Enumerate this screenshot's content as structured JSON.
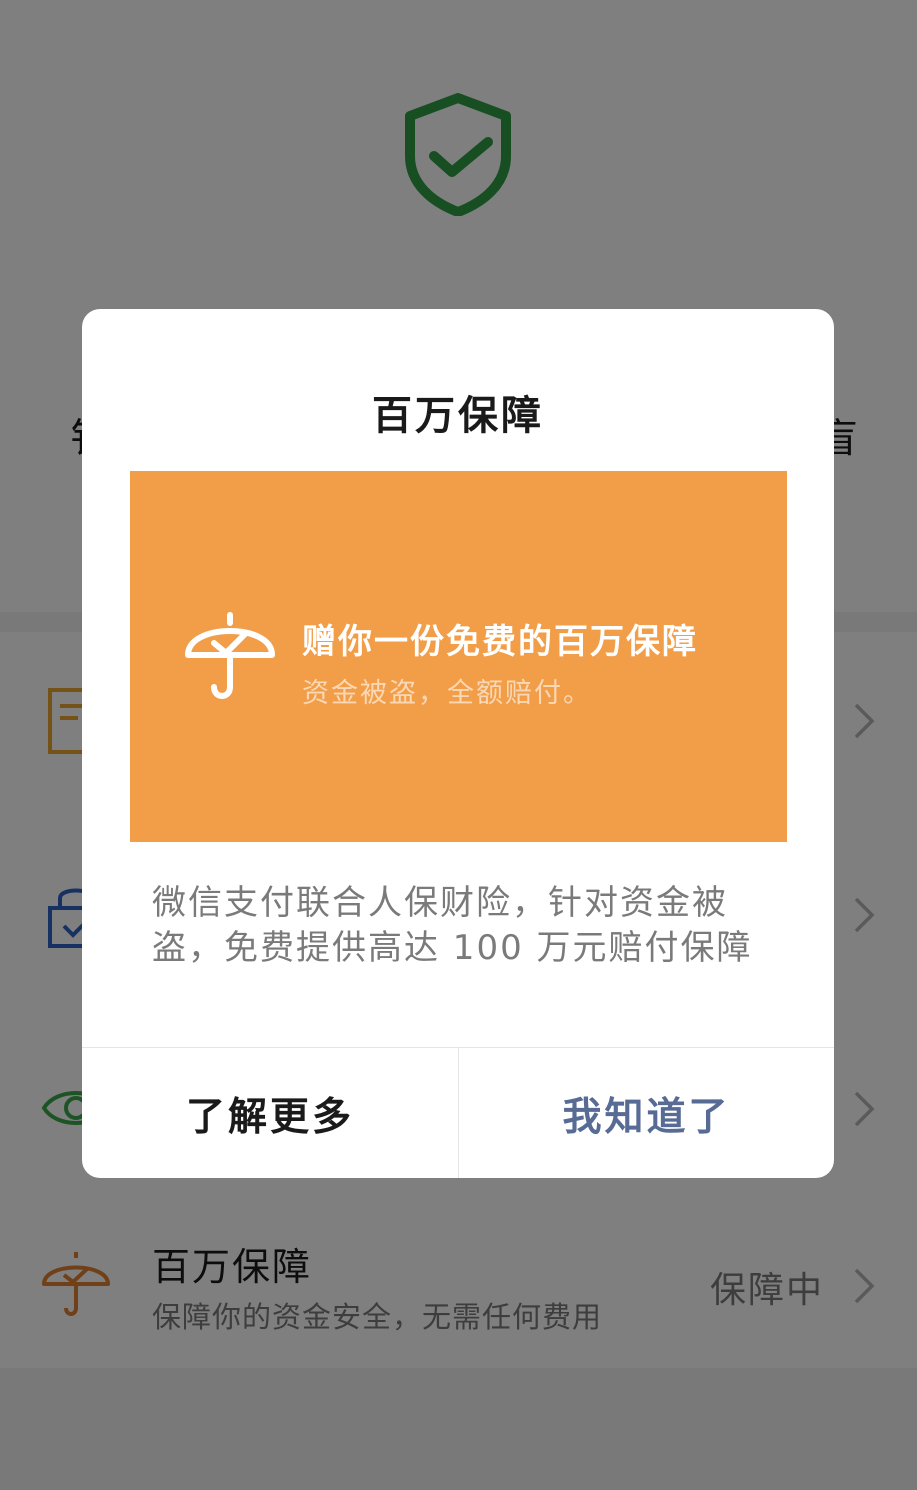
{
  "background": {
    "hero_left_text": "钅",
    "hero_right_text": "盲",
    "rows": [
      {
        "icon": "document-icon",
        "icon_color": "#e9a531"
      },
      {
        "icon": "lock-check-icon",
        "icon_color": "#2f62c6"
      },
      {
        "icon": "eye-icon",
        "icon_color": "#38a84a"
      },
      {
        "icon": "umbrella-check-icon",
        "icon_color": "#e08130",
        "title": "百万保障",
        "subtitle": "保障你的资金安全，无需任何费用",
        "status": "保障中"
      }
    ]
  },
  "modal": {
    "title": "百万保障",
    "banner": {
      "headline": "赠你一份免费的百万保障",
      "subline": "资金被盗，全额赔付。",
      "color": "#f29e48"
    },
    "description_line1": "微信支付联合人保财险，针对资金被",
    "description_line2": "盗，免费提供高达 100 万元赔付保障",
    "buttons": {
      "learn_more": "了解更多",
      "got_it": "我知道了"
    },
    "accent_color": "#576b95"
  }
}
